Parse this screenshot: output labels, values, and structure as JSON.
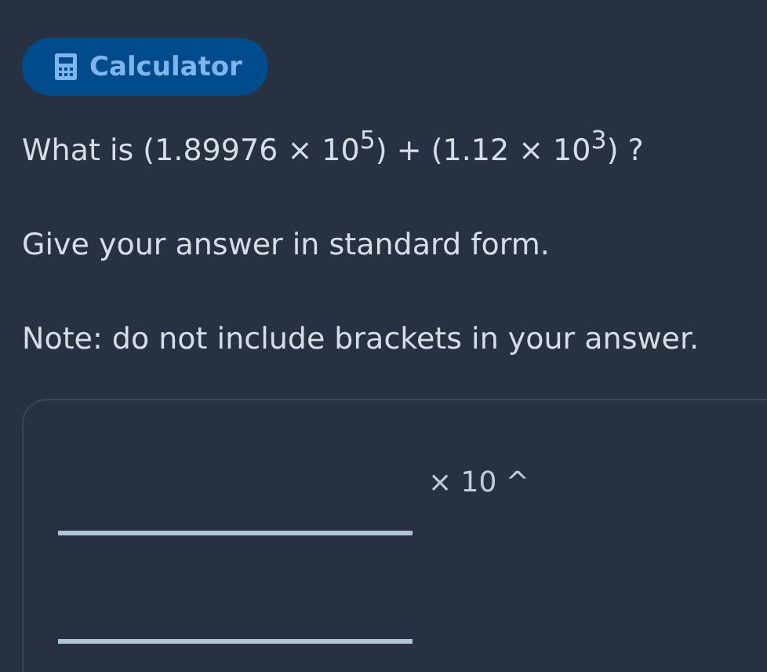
{
  "calculator_button": {
    "label": "Calculator"
  },
  "question": "What is  (1.89976 × 10$^{5}$) + (1.12 × 10$^{3}$) ?",
  "instructions": [
    "Give your answer in standard form.",
    "Note: do not include brackets in your answer."
  ],
  "answer": {
    "power_label": "× 10 ^"
  }
}
